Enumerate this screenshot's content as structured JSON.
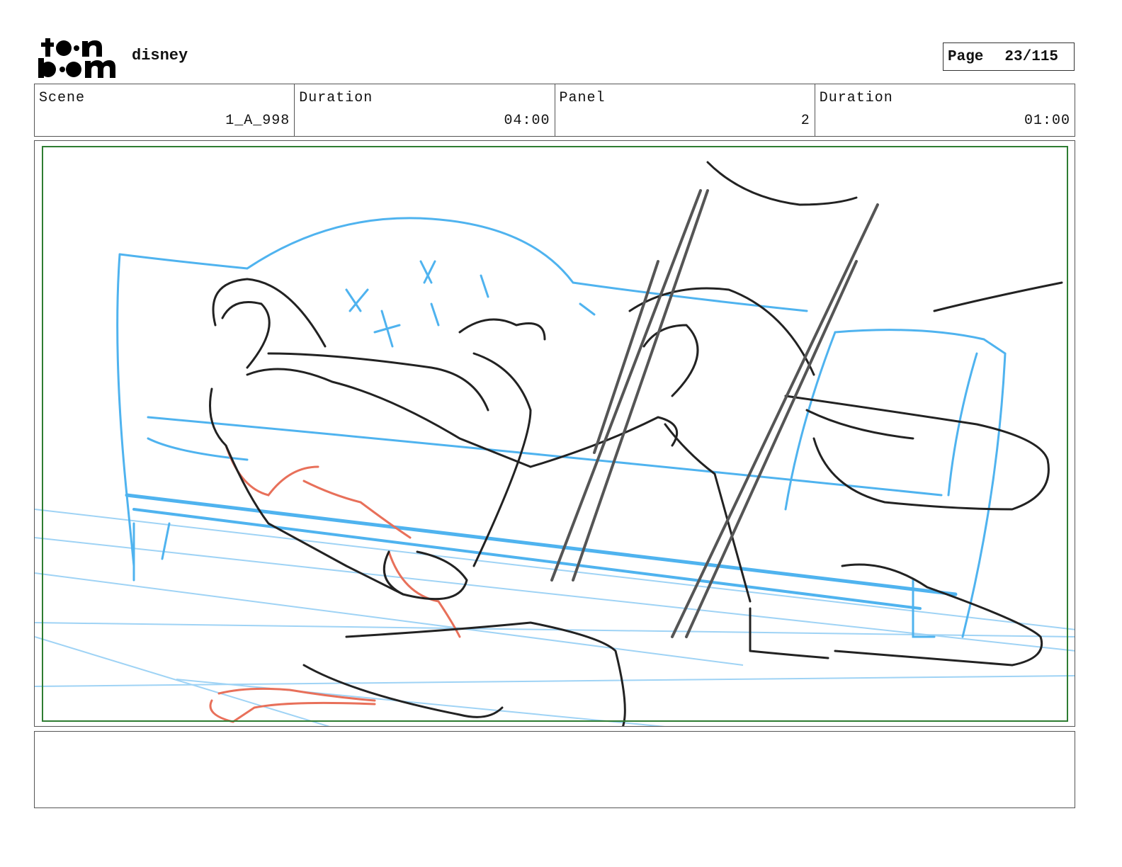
{
  "header": {
    "logo_text": "toon boom",
    "project_name": "disney",
    "page_label": "Page",
    "page_number": "23/115"
  },
  "info": {
    "scene_label": "Scene",
    "scene_value": "1_A_998",
    "scene_duration_label": "Duration",
    "scene_duration_value": "04:00",
    "panel_label": "Panel",
    "panel_value": "2",
    "panel_duration_label": "Duration",
    "panel_duration_value": "01:00"
  },
  "panel": {
    "image": "rough storyboard sketch of a figure lounging on a tufted sofa",
    "safe_frame_color": "#2e7d32",
    "sketch_colors": {
      "construction": "#4fb3ef",
      "lines": "#222222",
      "accent": "#e8705a"
    }
  },
  "notes": {
    "text": ""
  }
}
